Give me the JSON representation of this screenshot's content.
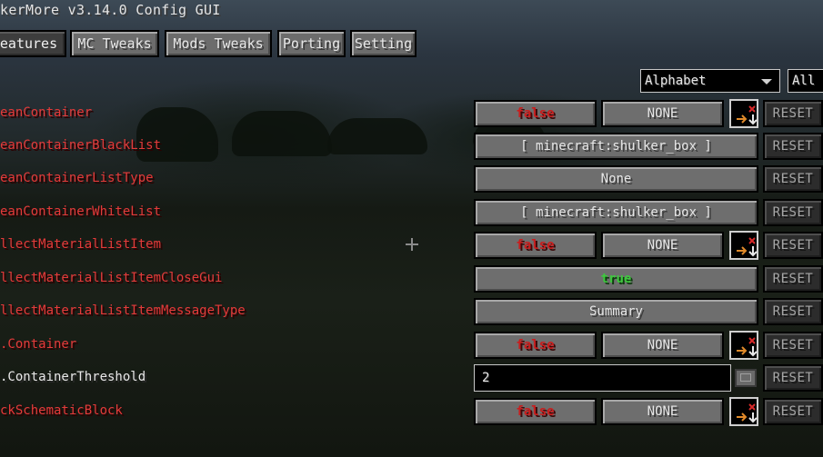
{
  "window": {
    "title": "kerMore v3.14.0 Config GUI"
  },
  "tabs": [
    {
      "label": "eatures",
      "active": true
    },
    {
      "label": "MC Tweaks",
      "active": false
    },
    {
      "label": "Mods Tweaks",
      "active": false
    },
    {
      "label": "Porting",
      "active": false
    },
    {
      "label": "Setting",
      "active": false
    }
  ],
  "filters": {
    "sort": {
      "selected": "Alphabet"
    },
    "category": {
      "selected": "All"
    }
  },
  "rows": [
    {
      "label": "eanContainer",
      "bool": "false",
      "hotkey": "NONE",
      "reset": "RESET"
    },
    {
      "label": "eanContainerBlackList",
      "value": "[ minecraft:shulker_box ]",
      "reset": "RESET"
    },
    {
      "label": "eanContainerListType",
      "value": "None",
      "reset": "RESET"
    },
    {
      "label": "eanContainerWhiteList",
      "value": "[ minecraft:shulker_box ]",
      "reset": "RESET"
    },
    {
      "label": "llectMaterialListItem",
      "bool": "false",
      "hotkey": "NONE",
      "reset": "RESET"
    },
    {
      "label": "llectMaterialListItemCloseGui",
      "value": "true",
      "reset": "RESET"
    },
    {
      "label": "llectMaterialListItemMessageType",
      "value": "Summary",
      "reset": "RESET"
    },
    {
      "label": ".Container",
      "bool": "false",
      "hotkey": "NONE",
      "reset": "RESET"
    },
    {
      "label": ".ContainerThreshold",
      "input": "2",
      "reset": "RESET"
    },
    {
      "label": "ckSchematicBlock",
      "bool": "false",
      "hotkey": "NONE",
      "reset": "RESET"
    }
  ],
  "colors": {
    "label_red": "#e43a3a",
    "label_white": "#e8e8e8",
    "false_text": "#c81e1e",
    "true_text": "#3ec83e"
  },
  "icons": {
    "hotkey_settings": "keybind-settings-icon",
    "lock": "lock-toggle-icon",
    "dropdown": "chevron-down-icon"
  }
}
